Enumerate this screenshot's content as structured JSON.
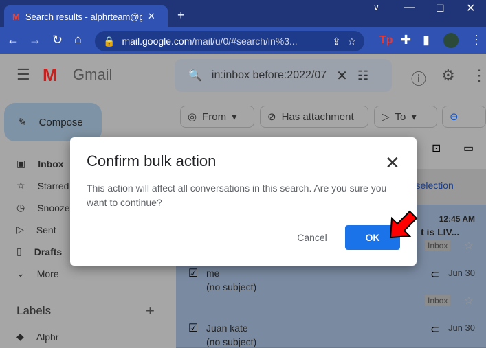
{
  "browser": {
    "tab_title": "Search results - alphrteam@gmai",
    "url_host": "mail.google.com",
    "url_path": "/mail/u/0/#search/in%3..."
  },
  "gmail": {
    "logo_text": "Gmail",
    "search_value": "in:inbox before:2022/07",
    "compose": "Compose",
    "filters": [
      "From",
      "Has attachment",
      "To"
    ],
    "nav": [
      "Inbox",
      "Starred",
      "Snoozed",
      "Sent",
      "Drafts",
      "More"
    ],
    "labels_title": "Labels",
    "labels": [
      "Alphr"
    ],
    "select_link": "r selection",
    "rows": [
      {
        "time": "12:45 AM",
        "subject": "t is LIV...",
        "tag": "Inbox"
      },
      {
        "sender": "me",
        "subject": "(no subject)",
        "date": "Jun 30",
        "tag": "Inbox"
      },
      {
        "sender": "Juan kate",
        "subject": "(no subject)",
        "date": "Jun 30"
      }
    ]
  },
  "dialog": {
    "title": "Confirm bulk action",
    "body": "This action will affect all conversations in this search. Are you sure you want to continue?",
    "cancel": "Cancel",
    "ok": "OK"
  },
  "colors": {
    "ok_button": "#1a73e8",
    "arrow": "#ff0000"
  }
}
